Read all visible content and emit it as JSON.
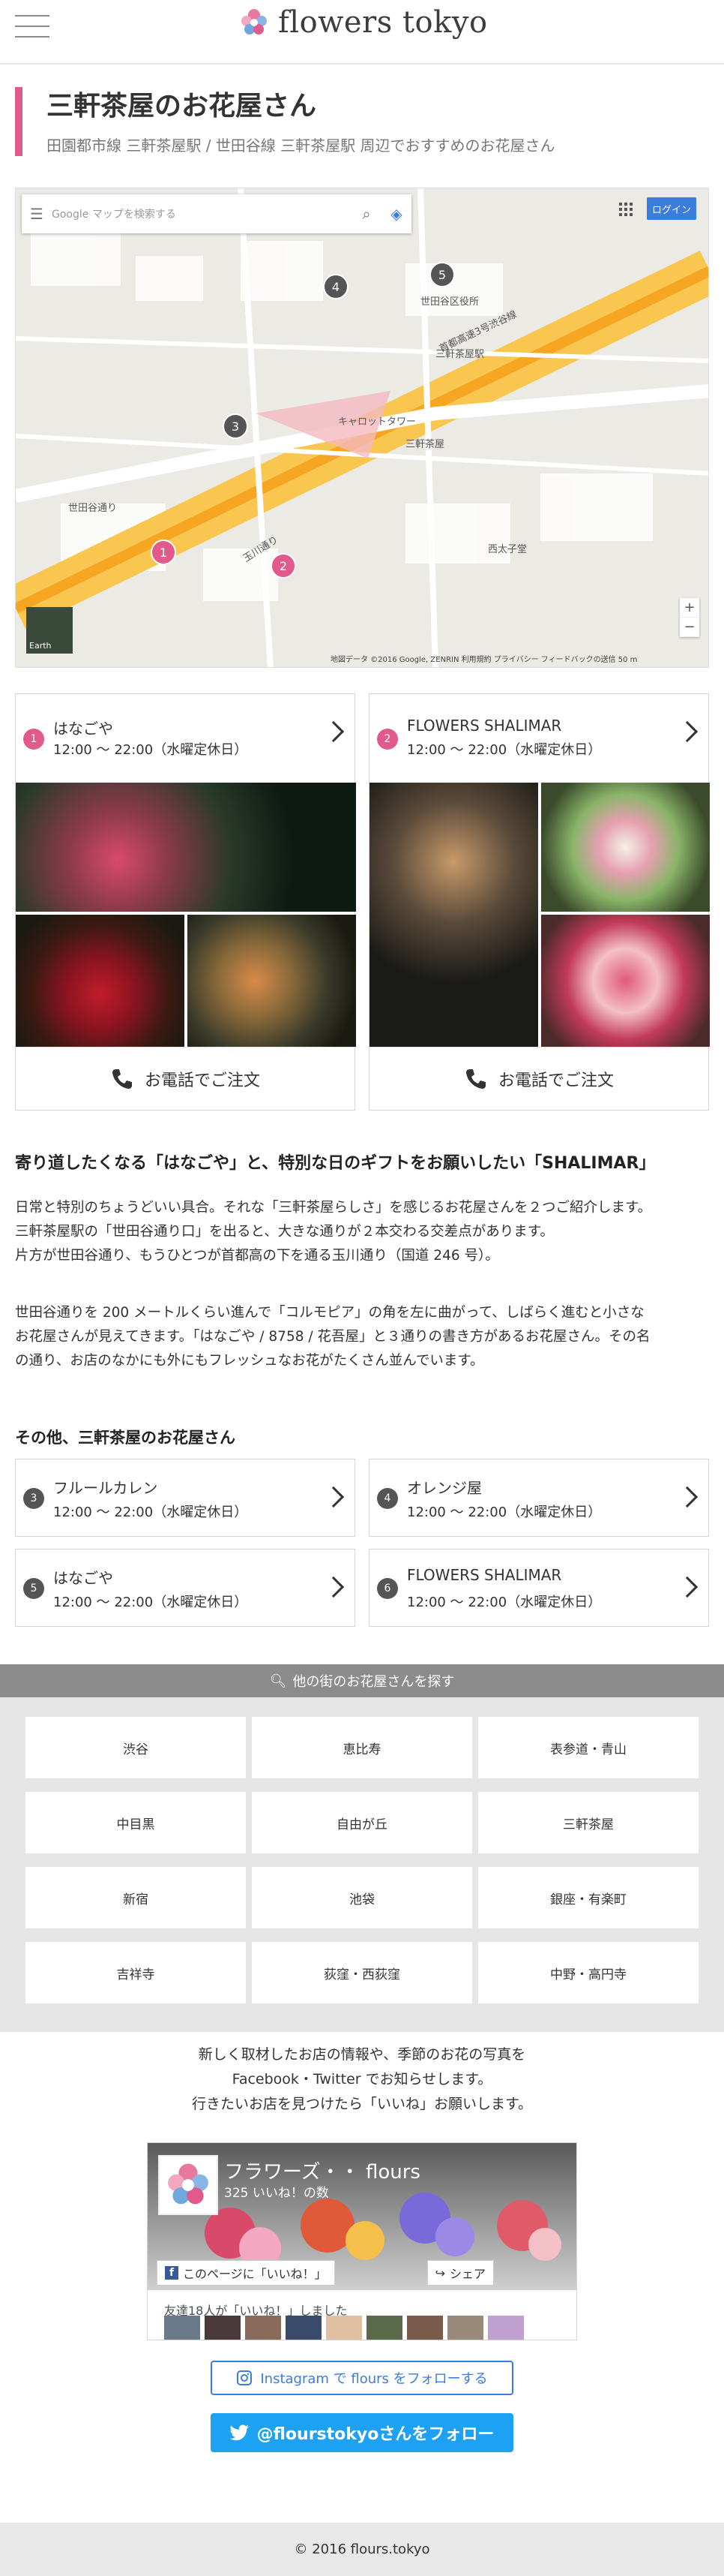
{
  "header": {
    "logo_text": "flowers tokyo",
    "menu_icon": "hamburger-icon"
  },
  "page": {
    "title": "三軒茶屋のお花屋さん",
    "subtitle": "田園都市線 三軒茶屋駅 / 世田谷線 三軒茶屋駅 周辺でおすすめのお花屋さん"
  },
  "map": {
    "search_placeholder": "Google マップを検索する",
    "login_label": "ログイン",
    "earth_label": "Earth",
    "attribution": "地図データ ©2016 Google, ZENRIN   利用規約   プライバシー   フィードバックの送信   50 m",
    "labels": [
      "三軒茶屋駅",
      "世田谷通り",
      "首都高速3号渋谷線",
      "キャロットタワー",
      "三軒茶屋",
      "玉川通り",
      "世田谷区役所",
      "西太子堂"
    ],
    "pins": [
      {
        "num": "1",
        "color": "pink"
      },
      {
        "num": "2",
        "color": "pink"
      },
      {
        "num": "3",
        "color": "gray"
      },
      {
        "num": "4",
        "color": "gray"
      },
      {
        "num": "5",
        "color": "gray"
      }
    ]
  },
  "shops": [
    {
      "num": "1",
      "name": "はなごや",
      "hours": "12:00 〜 22:00（水曜定休日）",
      "phone_label": "お電話でご注文"
    },
    {
      "num": "2",
      "name": "FLOWERS SHALIMAR",
      "hours": "12:00 〜 22:00（水曜定休日）",
      "phone_label": "お電話でご注文"
    }
  ],
  "article": {
    "heading": "寄り道したくなる「はなごや」と、特別な日のギフトをお願いしたい「SHALIMAR」",
    "para1_line1": "日常と特別のちょうどいい具合。それな「三軒茶屋らしさ」を感じるお花屋さんを２つご紹介します。",
    "para1_line2": "三軒茶屋駅の「世田谷通り口」を出ると、大きな通りが２本交わる交差点があります。",
    "para1_line3": "片方が世田谷通り、もうひとつが首都高の下を通る玉川通り（国道 246 号）。",
    "para2_line1": "世田谷通りを 200 メートルくらい進んで「コルモピア」の角を左に曲がって、しばらく進むと小さな",
    "para2_line2": "お花屋さんが見えてきます。「はなごや / 8758 / 花吾屋」と３通りの書き方があるお花屋さん。その名",
    "para2_line3": "の通り、お店のなかにも外にもフレッシュなお花がたくさん並んでいます。"
  },
  "others": {
    "heading": "その他、三軒茶屋のお花屋さん",
    "items": [
      {
        "num": "3",
        "name": "フルールカレン",
        "hours": "12:00 〜 22:00（水曜定休日）"
      },
      {
        "num": "4",
        "name": "オレンジ屋",
        "hours": "12:00 〜 22:00（水曜定休日）"
      },
      {
        "num": "5",
        "name": "はなごや",
        "hours": "12:00 〜 22:00（水曜定休日）"
      },
      {
        "num": "6",
        "name": "FLOWERS SHALIMAR",
        "hours": "12:00 〜 22:00（水曜定休日）"
      }
    ]
  },
  "areas": {
    "header": "他の街のお花屋さんを探す",
    "items": [
      "渋谷",
      "恵比寿",
      "表参道・青山",
      "中目黒",
      "自由が丘",
      "三軒茶屋",
      "新宿",
      "池袋",
      "銀座・有楽町",
      "吉祥寺",
      "荻窪・西荻窪",
      "中野・高円寺"
    ]
  },
  "social": {
    "line1": "新しく取材したお店の情報や、季節のお花の写真を",
    "line2": "Facebook・Twitter でお知らせします。",
    "line3": "行きたいお店を見つけたら「いいね」お願いします。",
    "fb_title": "フラワーズ・・ flours",
    "fb_likes": "325 いいね！の数",
    "fb_like_label": "このページに「いいね！」",
    "fb_share_label": "シェア",
    "fb_friends": "友達18人が「いいね！」しました",
    "instagram_label": "Instagram で flours をフォローする",
    "twitter_label": "@flourstokyoさんをフォロー"
  },
  "footer": {
    "copyright": "© 2016 flours.tokyo"
  },
  "colors": {
    "accent": "#e05a8c",
    "twitter": "#1da1f2",
    "instagram": "#3b7ddd"
  }
}
